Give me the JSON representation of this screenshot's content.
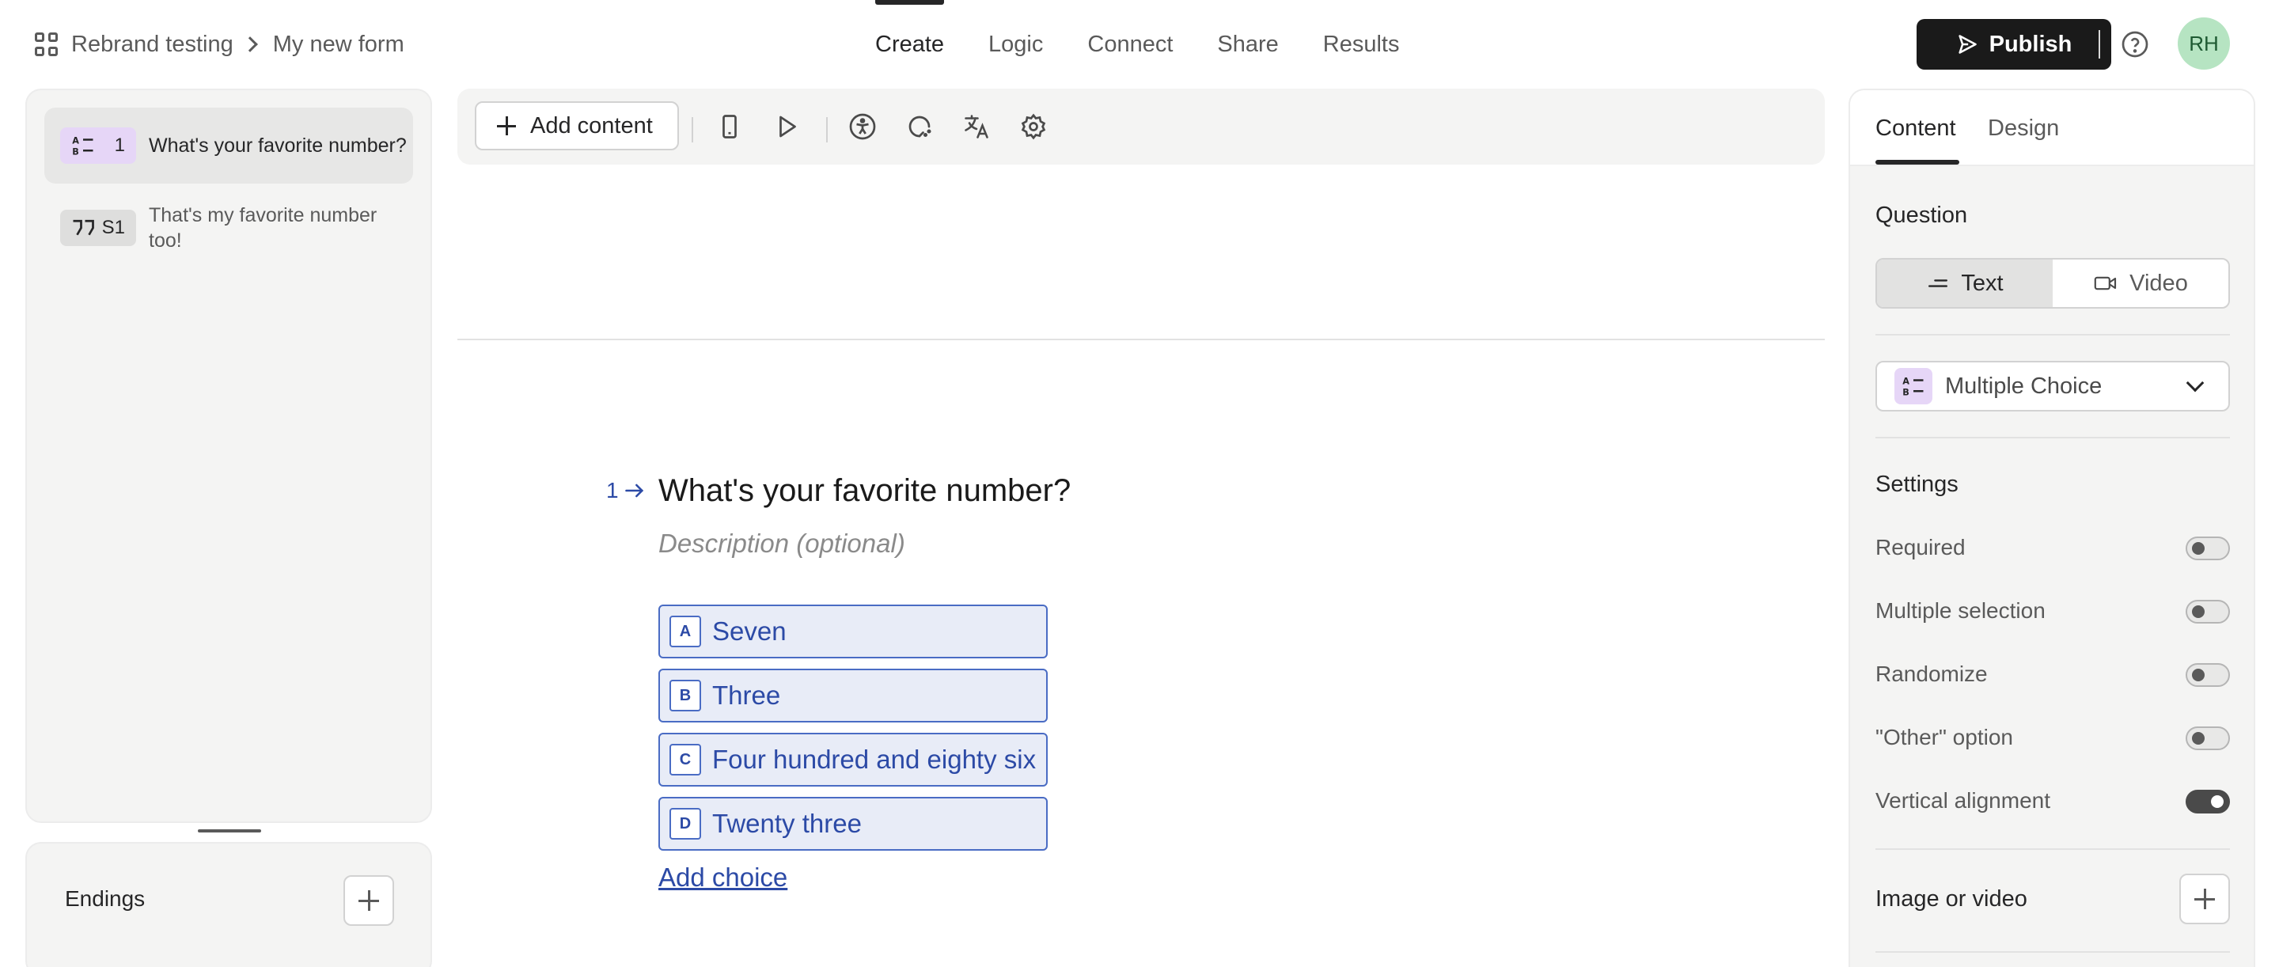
{
  "breadcrumb": {
    "workspace": "Rebrand testing",
    "form": "My new form"
  },
  "nav_tabs": [
    {
      "label": "Create",
      "active": true
    },
    {
      "label": "Logic",
      "active": false
    },
    {
      "label": "Connect",
      "active": false
    },
    {
      "label": "Share",
      "active": false
    },
    {
      "label": "Results",
      "active": false
    }
  ],
  "header": {
    "publish_label": "Publish",
    "avatar_initials": "RH"
  },
  "sidebar": {
    "questions": [
      {
        "badge": "1",
        "text": "What's your favorite number?",
        "type_icon": "multiple-choice-icon",
        "selected": true
      },
      {
        "badge": "S1",
        "text": "That's my favorite number too!",
        "type_icon": "quote-icon",
        "selected": false
      }
    ],
    "endings_label": "Endings"
  },
  "toolbar": {
    "add_content_label": "Add content",
    "icons": [
      "mobile-preview-icon",
      "play-icon",
      "accessibility-icon",
      "loading-icon",
      "translate-icon",
      "settings-gear-icon"
    ]
  },
  "question": {
    "number": "1",
    "title": "What's your favorite number?",
    "description_placeholder": "Description (optional)",
    "choices": [
      {
        "key": "A",
        "label": "Seven"
      },
      {
        "key": "B",
        "label": "Three"
      },
      {
        "key": "C",
        "label": "Four hundred and eighty six"
      },
      {
        "key": "D",
        "label": "Twenty three"
      }
    ],
    "add_choice_label": "Add choice"
  },
  "right_panel": {
    "tabs": [
      {
        "label": "Content",
        "active": true
      },
      {
        "label": "Design",
        "active": false
      }
    ],
    "question_section_label": "Question",
    "question_format": {
      "text_label": "Text",
      "video_label": "Video",
      "selected": "Text"
    },
    "question_type": "Multiple Choice",
    "settings_label": "Settings",
    "settings": [
      {
        "label": "Required",
        "on": false
      },
      {
        "label": "Multiple selection",
        "on": false
      },
      {
        "label": "Randomize",
        "on": false
      },
      {
        "label": "\"Other\" option",
        "on": false
      },
      {
        "label": "Vertical alignment",
        "on": true
      }
    ],
    "image_video_label": "Image or video"
  },
  "colors": {
    "accent_blue": "#2c4aa6",
    "choice_bg": "#e8ecf7",
    "publish_bg": "#1a1a1a",
    "mc_badge": "#e6d6f7",
    "avatar_bg": "#b6e4c2"
  }
}
